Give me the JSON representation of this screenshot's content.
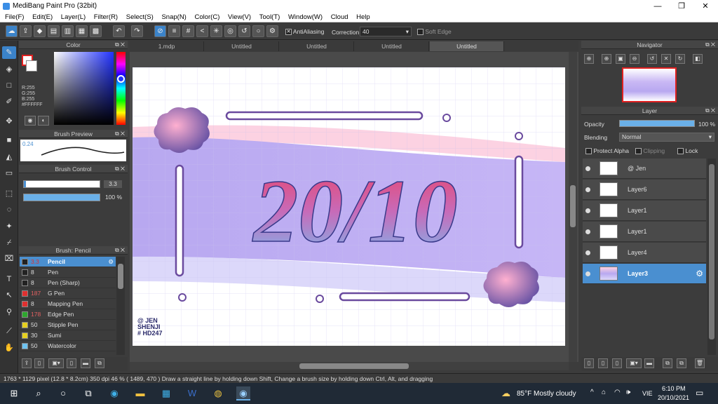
{
  "app": {
    "title": "MediBang Paint Pro (32bit)"
  },
  "menu": [
    "File(F)",
    "Edit(E)",
    "Layer(L)",
    "Filter(R)",
    "Select(S)",
    "Snap(N)",
    "Color(C)",
    "View(V)",
    "Tool(T)",
    "Window(W)",
    "Cloud",
    "Help"
  ],
  "toolbar": {
    "antialiasing_label": "AntiAliasing",
    "correction_label": "Correction",
    "correction_value": "40",
    "soft_edge_label": "Soft Edge"
  },
  "color_panel": {
    "title": "Color",
    "rgb_text": "R:255\nG:255\nB:255",
    "hex": "#FFFFFF",
    "fg": "#ffffff",
    "bg": "#ffffff"
  },
  "brush_preview": {
    "title": "Brush Preview",
    "size": "0.24"
  },
  "brush_control": {
    "title": "Brush Control",
    "size_value": "3.3",
    "opacity_value": "100 %"
  },
  "brush_list": {
    "title": "Brush: Pencil",
    "items": [
      {
        "size": "3.3",
        "name": "Pencil",
        "color": "#222222",
        "selected": true
      },
      {
        "size": "8",
        "name": "Pen",
        "color": "#222222"
      },
      {
        "size": "8",
        "name": "Pen (Sharp)",
        "color": "#222222"
      },
      {
        "size": "187",
        "name": "G Pen",
        "color": "#e03030"
      },
      {
        "size": "8",
        "name": "Mapping Pen",
        "color": "#e03030"
      },
      {
        "size": "178",
        "name": "Edge Pen",
        "color": "#2ea82e"
      },
      {
        "size": "50",
        "name": "Stipple Pen",
        "color": "#e6d020"
      },
      {
        "size": "30",
        "name": "Sumi",
        "color": "#e6d020"
      },
      {
        "size": "50",
        "name": "Watercolor",
        "color": "#6ec3f0"
      }
    ]
  },
  "tabs": [
    "1.mdp",
    "Untitled",
    "Untitled",
    "Untitled",
    "Untitled"
  ],
  "canvas": {
    "title_text": "20/10",
    "signature": "@ JEN\nSHENJI\n# HD247"
  },
  "navigator": {
    "title": "Navigator"
  },
  "layer_panel": {
    "title": "Layer",
    "opacity_label": "Opacity",
    "opacity_value": "100 %",
    "blending_label": "Blending",
    "blending_value": "Normal",
    "protect_alpha": "Protect Alpha",
    "clipping": "Clipping",
    "lock": "Lock",
    "layers": [
      {
        "name": "@ Jen"
      },
      {
        "name": "Layer6"
      },
      {
        "name": "Layer1"
      },
      {
        "name": "Layer1"
      },
      {
        "name": "Layer4"
      },
      {
        "name": "Layer3",
        "selected": true
      }
    ]
  },
  "status": {
    "text": "1763 * 1129 pixel   (12.8 * 8.2cm)   350 dpi   46 %   ( 1489, 470 )   Draw a straight line by holding down Shift, Change a brush size by holding down Ctrl, Alt, and dragging"
  },
  "taskbar": {
    "weather": "85°F  Mostly cloudy",
    "lang": "VIE",
    "time": "6:10 PM",
    "date": "20/10/2021"
  }
}
